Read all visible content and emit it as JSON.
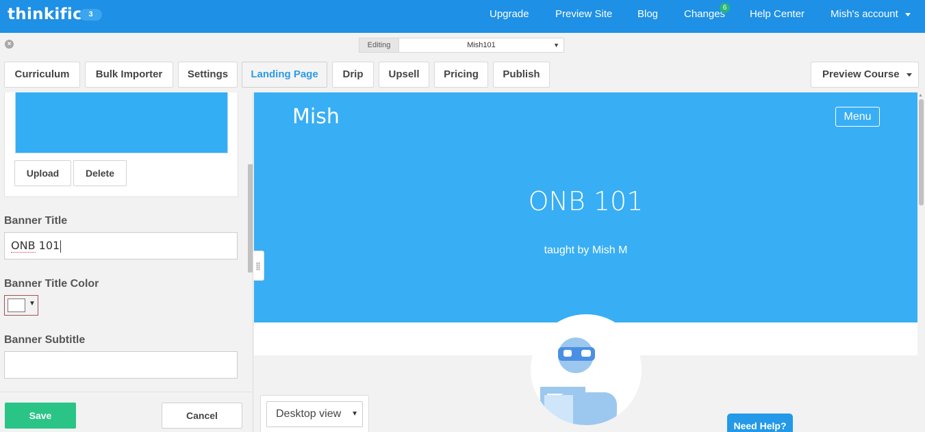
{
  "header": {
    "logo": "thinkific",
    "badge_count": "3",
    "nav": {
      "upgrade": "Upgrade",
      "preview_site": "Preview Site",
      "blog": "Blog",
      "changes": "Changes",
      "changes_badge": "6",
      "help_center": "Help Center",
      "account": "Mish's account"
    }
  },
  "editing": {
    "label": "Editing",
    "selected_course": "Mish101"
  },
  "tabs": {
    "curriculum": "Curriculum",
    "bulk_importer": "Bulk Importer",
    "settings": "Settings",
    "landing_page": "Landing Page",
    "drip": "Drip",
    "upsell": "Upsell",
    "pricing": "Pricing",
    "publish": "Publish",
    "active": "Landing Page"
  },
  "preview_course": "Preview Course",
  "left_panel": {
    "upload": "Upload",
    "delete": "Delete",
    "banner_title_label": "Banner Title",
    "banner_title_value_word": "ONB",
    "banner_title_value_num": "101",
    "banner_title_color_label": "Banner Title Color",
    "banner_title_color_value": "#ffffff",
    "banner_subtitle_label": "Banner Subtitle",
    "banner_subtitle_value": "",
    "save": "Save",
    "cancel": "Cancel"
  },
  "preview": {
    "site_name": "Mish",
    "menu": "Menu",
    "course_title": "ONB 101",
    "subtitle": "taught by Mish M",
    "view_mode": "Desktop view"
  },
  "need_help": "Need Help?",
  "colors": {
    "topbar": "#1e90e5",
    "banner": "#38aef4",
    "accent": "#2a9be8",
    "save": "#2ac486"
  }
}
